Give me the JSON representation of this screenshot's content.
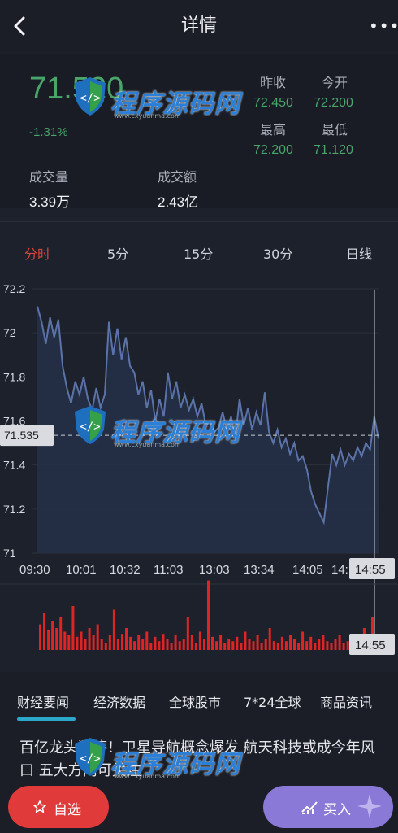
{
  "header": {
    "title": "详情",
    "more_glyph": "•••"
  },
  "quote": {
    "price": "71.520",
    "change_pct": "-1.31%",
    "prev_close_label": "昨收",
    "prev_close": "72.450",
    "open_label": "今开",
    "open": "72.200",
    "high_label": "最高",
    "high": "72.200",
    "low_label": "最低",
    "low": "71.120",
    "volume_label": "成交量",
    "volume": "3.39万",
    "turnover_label": "成交额",
    "turnover": "2.43亿"
  },
  "period_tabs": [
    {
      "label": "分时",
      "active": true
    },
    {
      "label": "5分",
      "active": false
    },
    {
      "label": "15分",
      "active": false
    },
    {
      "label": "30分",
      "active": false
    },
    {
      "label": "日线",
      "active": false
    }
  ],
  "chart_data": {
    "type": "line",
    "ylim": [
      71,
      72.2
    ],
    "y_ticks": [
      "72.2",
      "72",
      "71.8",
      "71.6",
      "71.4",
      "71.2",
      "71"
    ],
    "x_ticks": [
      "09:30",
      "10:01",
      "10:32",
      "11:03",
      "13:03",
      "13:34",
      "14:05",
      "14:"
    ],
    "reference_label": "71.535",
    "reference_value": 71.535,
    "cursor_time_label": "14:55",
    "volume_cursor_label": "14:55",
    "series": [
      {
        "values": [
          72.12,
          72.05,
          71.95,
          72.07,
          71.98,
          72.06,
          71.85,
          71.75,
          71.68,
          71.78,
          71.72,
          71.8,
          71.7,
          71.65,
          71.75,
          71.66,
          71.72,
          72.05,
          71.9,
          72.02,
          71.88,
          71.98,
          71.85,
          71.82,
          71.72,
          71.78,
          71.66,
          71.74,
          71.6,
          71.7,
          71.62,
          71.82,
          71.7,
          71.78,
          71.66,
          71.72,
          71.65,
          71.7,
          71.62,
          71.68,
          71.58,
          71.6,
          71.55,
          71.57,
          71.64,
          71.56,
          71.62,
          71.52,
          71.7,
          71.58,
          71.66,
          71.56,
          71.64,
          71.58,
          71.73,
          71.55,
          71.5,
          71.56,
          71.48,
          71.52,
          71.45,
          71.5,
          71.42,
          71.44,
          71.38,
          71.28,
          71.22,
          71.18,
          71.14,
          71.3,
          71.45,
          71.4,
          71.47,
          71.4,
          71.45,
          71.42,
          71.48,
          71.44,
          71.5,
          71.47,
          71.62,
          71.52
        ]
      }
    ],
    "volume": {
      "values": [
        0.35,
        0.5,
        0.28,
        0.4,
        0.3,
        0.45,
        0.25,
        0.2,
        0.6,
        0.18,
        0.25,
        0.15,
        0.3,
        0.2,
        0.35,
        0.15,
        0.1,
        0.2,
        0.55,
        0.15,
        0.22,
        0.3,
        0.18,
        0.12,
        0.2,
        0.15,
        0.25,
        0.1,
        0.18,
        0.12,
        0.22,
        0.15,
        0.1,
        0.2,
        0.12,
        0.15,
        0.45,
        0.2,
        0.1,
        0.25,
        0.15,
        0.95,
        0.18,
        0.12,
        0.2,
        0.1,
        0.15,
        0.12,
        0.18,
        0.1,
        0.25,
        0.15,
        0.12,
        0.2,
        0.1,
        0.15,
        0.3,
        0.12,
        0.1,
        0.18,
        0.12,
        0.2,
        0.15,
        0.1,
        0.25,
        0.12,
        0.18,
        0.1,
        0.15,
        0.2,
        0.12,
        0.1,
        0.15,
        0.2,
        0.1,
        0.12,
        0.15,
        0.1,
        0.18,
        0.3,
        0.2,
        0.45
      ],
      "color": "#e02424"
    },
    "colors": {
      "line": "#5b73a8",
      "fill": "#243049"
    }
  },
  "news": {
    "tabs": [
      "财经要闻",
      "经济数据",
      "全球股市",
      "7*24全球",
      "商品资讯"
    ],
    "headline": "百亿龙头涨停！卫星导航概念爆发 航天科技或成今年风口 五大方向可关注"
  },
  "actions": {
    "favorite_label": "自选",
    "buy_label": "买入"
  },
  "watermark": {
    "text": "程序源码网",
    "sub": "www.cxyuanma.com"
  },
  "colors": {
    "up_red": "#e03a3a",
    "down_green": "#4aa56b",
    "accent_cyan": "#2aa7c9",
    "buy_purple": "#8b79d8"
  }
}
